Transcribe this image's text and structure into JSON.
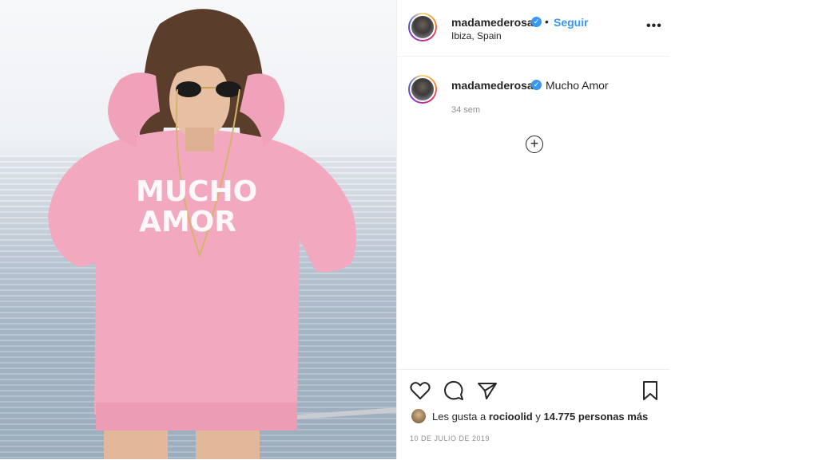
{
  "post": {
    "username": "madamederosa",
    "follow_label": "Seguir",
    "dot": "•",
    "location": "Ibiza, Spain",
    "more_icon": "more-options-icon",
    "more_glyph": "•••",
    "verified_glyph": "✓",
    "caption": "Mucho Amor",
    "time_ago": "34 sem",
    "add_comment_glyph": "+",
    "likes": {
      "prefix": "Les gusta a",
      "user": "rocioolid",
      "connector": "y",
      "count": "14.775 personas más"
    },
    "date": "10 DE JULIO DE 2019"
  },
  "photo": {
    "sweater_text_line1": "MUCHO",
    "sweater_text_line2": "AMOR"
  },
  "colors": {
    "accent": "#3897f0",
    "text": "#262626",
    "muted": "#8e8e8e",
    "sweater": "#f2a9c0"
  },
  "icons": [
    "heart-icon",
    "comment-icon",
    "share-icon",
    "bookmark-icon",
    "add-comment-icon",
    "verified-badge-icon"
  ]
}
